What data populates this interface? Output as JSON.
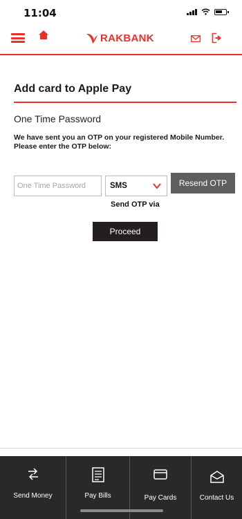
{
  "status_bar": {
    "time": "11:04"
  },
  "header": {
    "brand": "RAKBANK",
    "accent_color": "#e8312a",
    "icons": [
      "menu-icon",
      "home-icon",
      "mail-icon",
      "logout-icon"
    ]
  },
  "page": {
    "title": "Add card to Apple Pay",
    "section_title": "One Time Password",
    "message": "We have sent you an OTP on your registered Mobile Number. Please enter the OTP below:",
    "otp_input": {
      "placeholder": "One Time Password",
      "value": ""
    },
    "channel_select": {
      "value": "SMS"
    },
    "resend_button": "Resend OTP",
    "send_via_label": "Send OTP via",
    "proceed_button": "Proceed"
  },
  "bottom_nav": {
    "background": "#2b2828",
    "items": [
      {
        "label": "Send Money",
        "icon": "transfer-arrows-icon"
      },
      {
        "label": "Pay Bills",
        "icon": "bill-icon"
      },
      {
        "label": "Pay Cards",
        "icon": "card-icon"
      },
      {
        "label": "Contact Us",
        "icon": "envelope-icon"
      }
    ]
  }
}
